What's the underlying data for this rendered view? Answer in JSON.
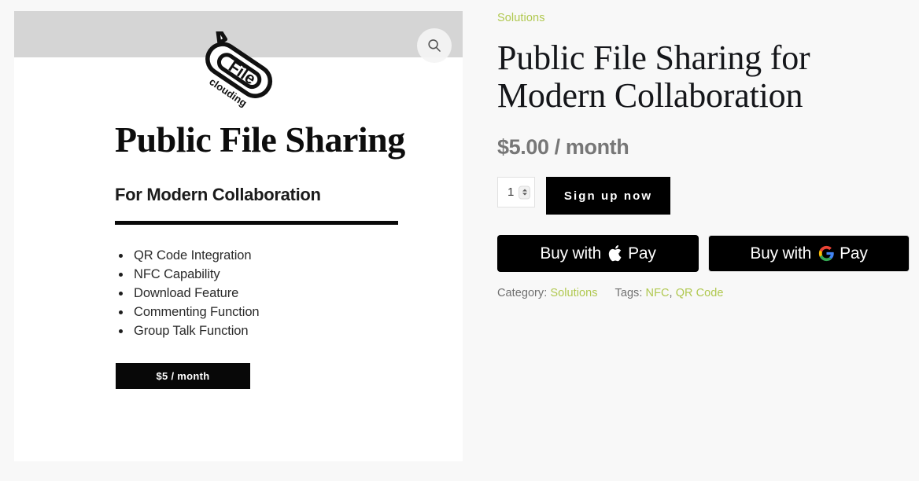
{
  "colors": {
    "accent": "#b0c84f",
    "page_bg": "#f8f8f8",
    "button_bg": "#000000",
    "price_text": "#777777",
    "band_gray": "#d5d5d5"
  },
  "gallery": {
    "zoom_icon": "magnifier-icon",
    "logo": {
      "line1": "File",
      "line2": "clouding"
    },
    "slide": {
      "title": "Public File Sharing",
      "subtitle": "For Modern Collaboration",
      "features": [
        "QR Code Integration",
        "NFC Capability",
        "Download Feature",
        "Commenting Function",
        "Group Talk Function"
      ],
      "badge": "$5 / month"
    }
  },
  "summary": {
    "breadcrumb": "Solutions",
    "title": "Public File Sharing for Modern Collaboration",
    "price": "$5.00 / month",
    "quantity": {
      "value": "1",
      "placeholder": "1"
    },
    "signup_label": "Sign up now",
    "payment_buttons": [
      {
        "prefix": "Buy with",
        "mark": "apple-logo-icon",
        "suffix": "Pay"
      },
      {
        "prefix": "Buy with",
        "mark": "google-g-logo-icon",
        "suffix": "Pay"
      }
    ],
    "meta": {
      "category_label": "Category:",
      "category_value": "Solutions",
      "tags_label": "Tags:",
      "tags": [
        "NFC",
        "QR Code"
      ],
      "tag_separator": ","
    }
  }
}
